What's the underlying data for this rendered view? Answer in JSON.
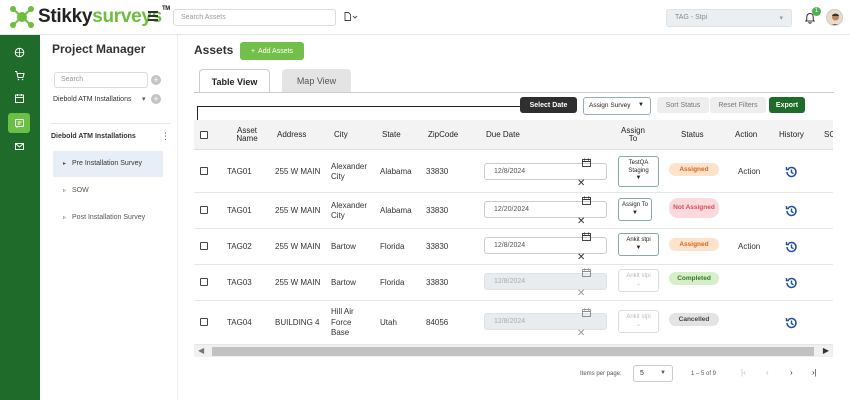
{
  "app": {
    "logo_part1": "Stikky",
    "logo_part2": "surveys",
    "logo_tm": "TM",
    "search_placeholder": "Search Assets",
    "tag_select": "TAG - Stpi",
    "notification_count": "1"
  },
  "project_manager": {
    "title": "Project Manager",
    "search_placeholder": "Search",
    "project": "Diebold ATM Installations",
    "folder": "Diebold ATM Installations",
    "items": [
      {
        "label": "Pre Installation Survey",
        "active": true
      },
      {
        "label": "SOW",
        "active": false
      },
      {
        "label": "Post Installation Survey",
        "active": false
      }
    ]
  },
  "main": {
    "title": "Assets",
    "add_button": "Add Assets",
    "tabs": [
      {
        "label": "Table View",
        "active": true
      },
      {
        "label": "Map View",
        "active": false
      }
    ],
    "filters": {
      "select_date": "Select Date",
      "assign_survey": "Assign Survey",
      "sort_status": "Sort Status",
      "reset_filters": "Reset Filters",
      "export": "Export"
    }
  },
  "table": {
    "columns": [
      "Asset Name",
      "Address",
      "City",
      "State",
      "ZipCode",
      "Due Date",
      "Assign To",
      "Status",
      "Action",
      "History",
      "SC"
    ],
    "rows": [
      {
        "asset": "TAG01",
        "address": "255 W MAIN",
        "city": "Alexander City",
        "state": "Alabama",
        "zip": "33830",
        "due": "12/8/2024",
        "assign": "TestQA Staging",
        "status": "Assigned",
        "status_kind": "assigned",
        "action": "Action",
        "editable": true
      },
      {
        "asset": "TAG01",
        "address": "255 W MAIN",
        "city": "Alexander City",
        "state": "Alabama",
        "zip": "33830",
        "due": "12/20/2024",
        "assign": "Assign To",
        "status": "Not Assigned",
        "status_kind": "notassigned",
        "action": "",
        "editable": true
      },
      {
        "asset": "TAG02",
        "address": "255 W MAIN",
        "city": "Bartow",
        "state": "Florida",
        "zip": "33830",
        "due": "12/8/2024",
        "assign": "Ankit stpi",
        "status": "Assigned",
        "status_kind": "assigned",
        "action": "Action",
        "editable": true
      },
      {
        "asset": "TAG03",
        "address": "255 W MAIN",
        "city": "Bartow",
        "state": "Florida",
        "zip": "33830",
        "due": "12/8/2024",
        "assign": "Ankit stpi",
        "status": "Completed",
        "status_kind": "completed",
        "action": "",
        "editable": false
      },
      {
        "asset": "TAG04",
        "address": "BUILDING 4",
        "city": "Hill Air Force Base",
        "state": "Utah",
        "zip": "84056",
        "due": "12/8/2024",
        "assign": "Ankit stpi",
        "status": "Cancelled",
        "status_kind": "cancelled",
        "action": "",
        "editable": false
      }
    ]
  },
  "pagination": {
    "items_per_page_label": "Items per page:",
    "items_per_page": "5",
    "range": "1 – 5 of 9"
  },
  "colors": {
    "brand_green": "#1e6b2a",
    "accent_green": "#72c04a"
  }
}
